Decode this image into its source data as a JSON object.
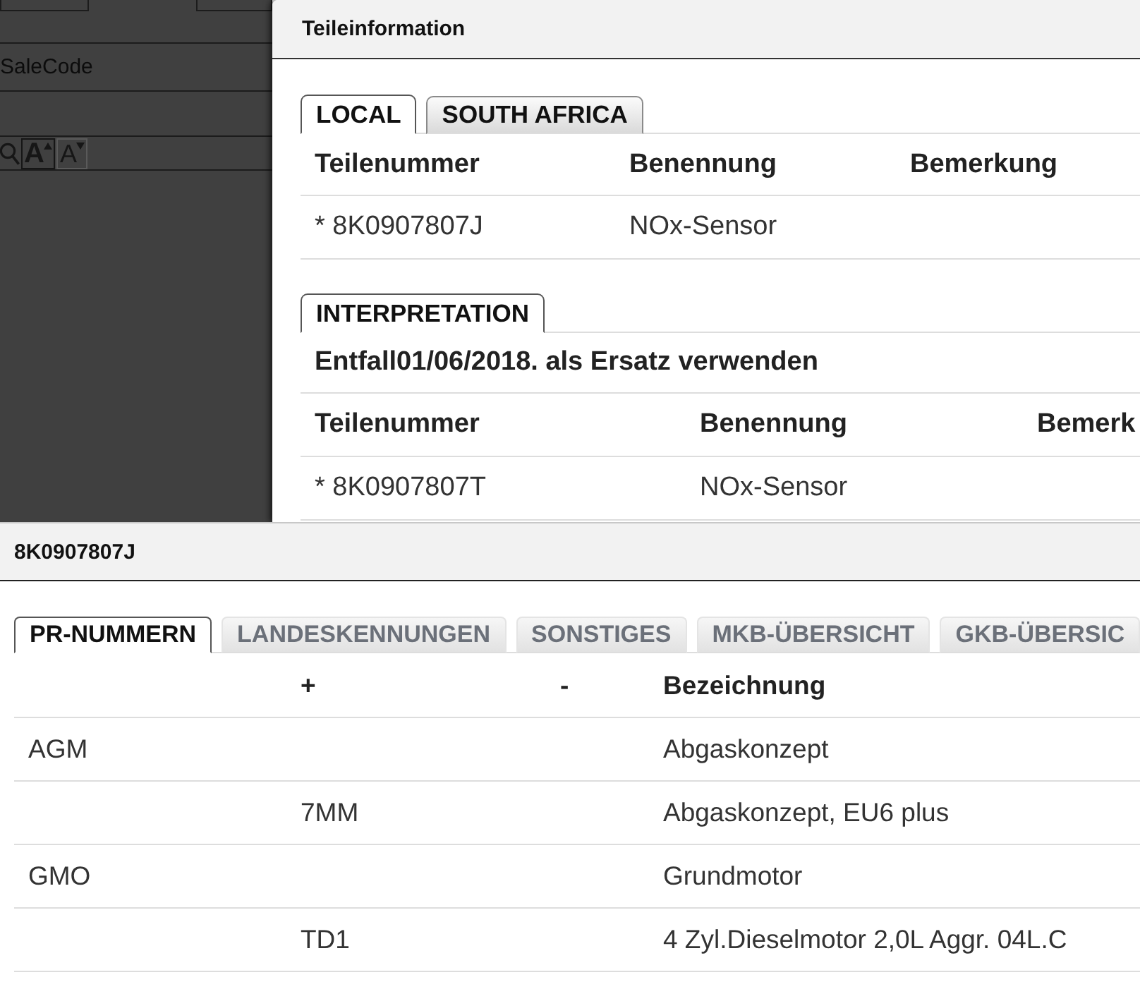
{
  "background_page": {
    "sale_code_field": {
      "placeholder": "SaleCode"
    },
    "font_size_buttons": [
      {
        "kind": "increase",
        "label": "A",
        "selected": true
      },
      {
        "kind": "decrease",
        "label": "A",
        "selected": false
      }
    ]
  },
  "parts_dialog": {
    "title": "Teileinformation",
    "region_tabs": [
      {
        "label": "LOCAL",
        "selected": true
      },
      {
        "label": "SOUTH AFRICA",
        "selected": false
      }
    ],
    "parts_table": {
      "columns": [
        "Teilenummer",
        "Benennung",
        "Bemerkung"
      ],
      "rows": [
        [
          "* 8K0907807J",
          "NOx-Sensor"
        ]
      ]
    },
    "interpretation_tabs": [
      {
        "label": "INTERPRETATION",
        "selected": true
      }
    ],
    "interpretation_note": "Entfall01/06/2018. als Ersatz verwenden",
    "replacement_table": {
      "columns": [
        "Teilenummer",
        "Benennung",
        "Bemerk"
      ],
      "rows": [
        [
          "* 8K0907807T",
          "NOx-Sensor"
        ]
      ]
    }
  },
  "detail_panel": {
    "title": "8K0907807J",
    "tabs": [
      {
        "label": "PR-NUMMERN",
        "selected": true
      },
      {
        "label": "LANDESKENNUNGEN",
        "selected": false
      },
      {
        "label": "SONSTIGES",
        "selected": false
      },
      {
        "label": "MKB-ÜBERSICHT",
        "selected": false
      },
      {
        "label": "GKB-ÜBERSIC",
        "selected": false
      }
    ],
    "pr_table": {
      "columns": {
        "plus": "+",
        "minus": "-",
        "bezeichnung": "Bezeichnung"
      },
      "rows": [
        {
          "column_1": "AGM",
          "bezeichnung": "Abgaskonzept"
        },
        {
          "plus": "7MM",
          "bezeichnung": "Abgaskonzept, EU6 plus"
        },
        {
          "column_1": "GMO",
          "bezeichnung": "Grundmotor"
        },
        {
          "plus": "TD1",
          "bezeichnung": "4 Zyl.Dieselmotor 2,0L Aggr. 04L.C"
        }
      ]
    }
  }
}
